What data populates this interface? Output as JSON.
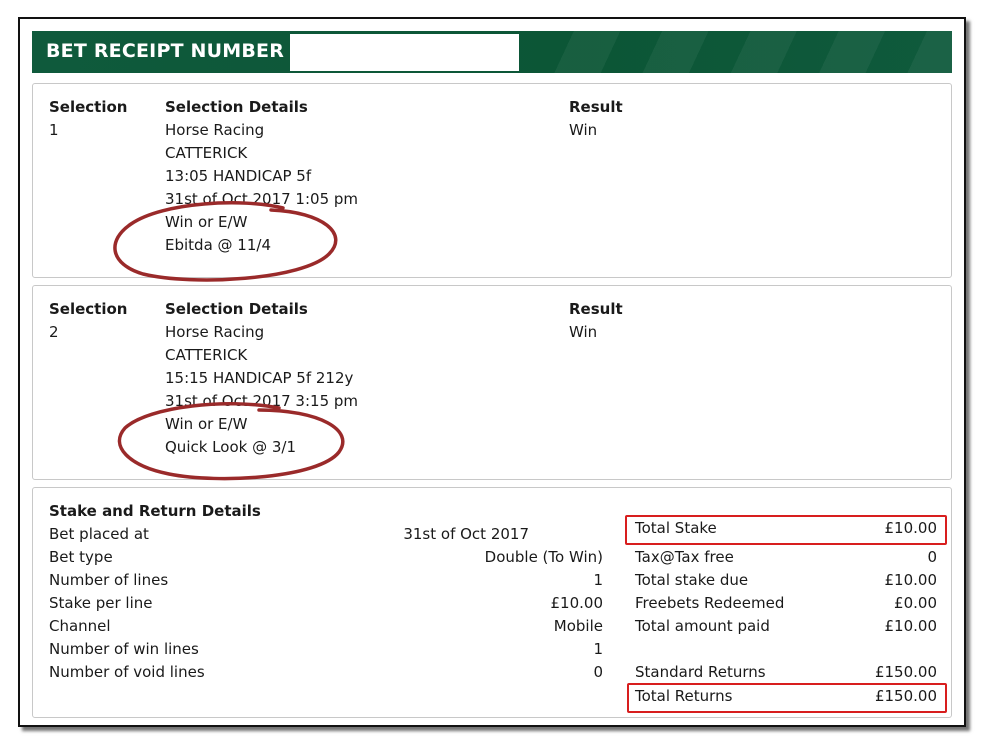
{
  "header": {
    "title": "BET RECEIPT NUMBER :",
    "receipt_number": ""
  },
  "columns": {
    "selection": "Selection",
    "details": "Selection Details",
    "result": "Result"
  },
  "selections": [
    {
      "number": "1",
      "details": [
        "Horse Racing",
        "CATTERICK",
        "13:05 HANDICAP 5f",
        "31st of Oct 2017 1:05 pm",
        "Win or E/W",
        "Ebitda @ 11/4"
      ],
      "result": "Win"
    },
    {
      "number": "2",
      "details": [
        "Horse Racing",
        "CATTERICK",
        "15:15 HANDICAP 5f 212y",
        "31st of Oct 2017 3:15 pm",
        "Win or E/W",
        "Quick Look @ 3/1"
      ],
      "result": "Win"
    }
  ],
  "stake": {
    "heading": "Stake and Return Details",
    "left": [
      {
        "label": "Bet placed at",
        "value": "31st of Oct 2017"
      },
      {
        "label": "Bet type",
        "value": "Double (To Win)"
      },
      {
        "label": "Number of lines",
        "value": "1"
      },
      {
        "label": "Stake per line",
        "value": "£10.00"
      },
      {
        "label": "Channel",
        "value": "Mobile"
      },
      {
        "label": "Number of win lines",
        "value": "1"
      },
      {
        "label": "Number of void lines",
        "value": "0"
      }
    ],
    "right": [
      {
        "label": "Total Stake",
        "value": "£10.00"
      },
      {
        "label": "Tax@Tax free",
        "value": "0"
      },
      {
        "label": "Total stake due",
        "value": "£10.00"
      },
      {
        "label": "Freebets Redeemed",
        "value": "£0.00"
      },
      {
        "label": "Total amount paid",
        "value": "£10.00"
      },
      {
        "label": "Standard Returns",
        "value": "£150.00"
      },
      {
        "label": "Total Returns",
        "value": "£150.00"
      }
    ]
  },
  "colors": {
    "header_green": "#0f5a3c",
    "highlight_red": "#d81e1e",
    "annotation": "#9a2a2a"
  }
}
